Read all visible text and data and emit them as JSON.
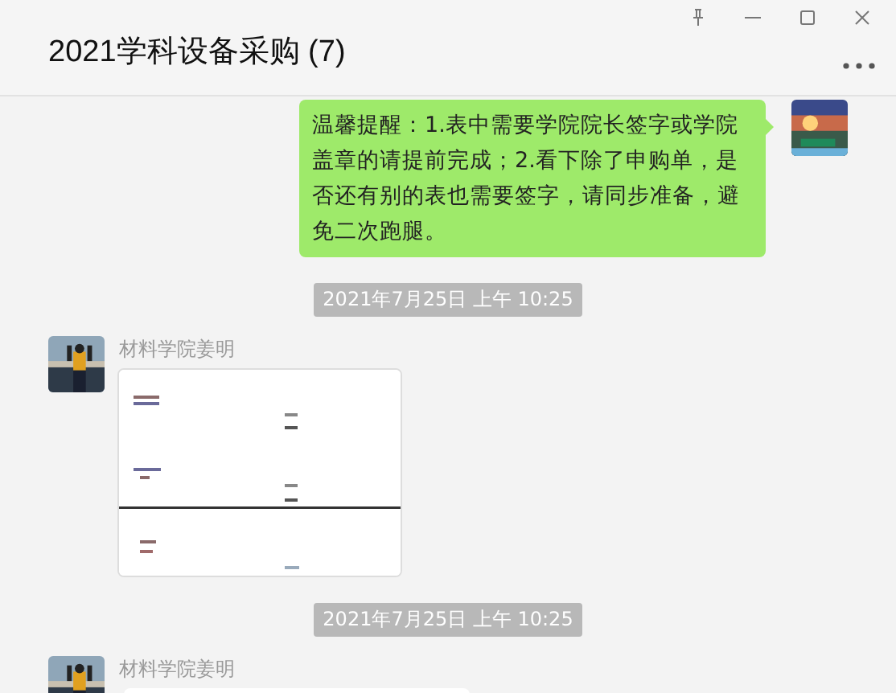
{
  "window": {
    "title": "2021学科设备采购 (7)"
  },
  "messages": [
    {
      "kind": "sent",
      "text": "温馨提醒：1.表中需要学院院长签字或学院盖章的请提前完成；2.看下除了申购单，是否还有别的表也需要签字，请同步准备，避免二次跑腿。"
    },
    {
      "kind": "time",
      "text": "2021年7月25日 上午 10:25"
    },
    {
      "sender": "材料学院姜明"
    },
    {
      "kind": "time",
      "text": "2021年7月25日 上午 10:25"
    },
    {
      "kind": "cut",
      "sender": "材料学院姜明"
    }
  ]
}
